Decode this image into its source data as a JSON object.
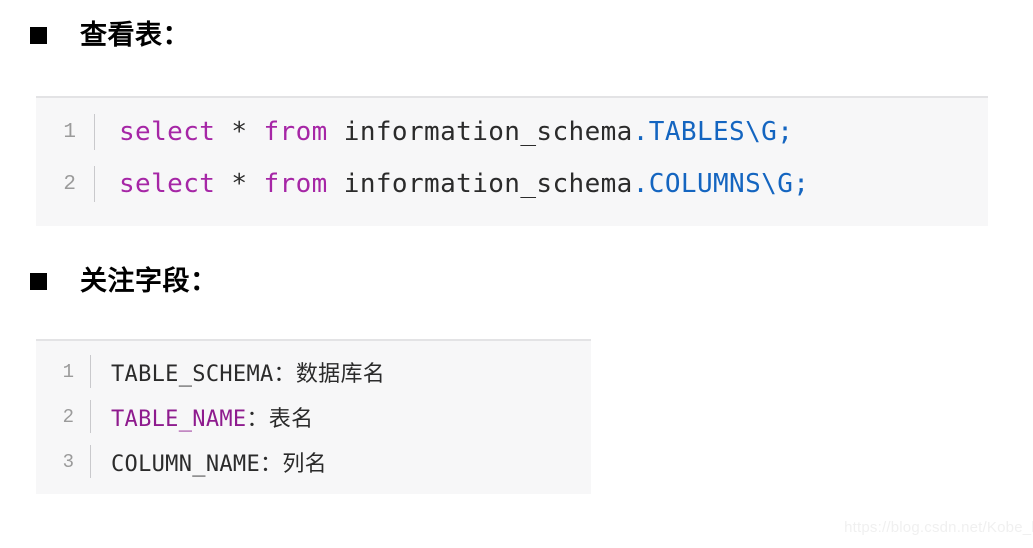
{
  "sections": [
    {
      "heading": "查看表：",
      "bullet": "filled-square-bullet"
    },
    {
      "heading": "关注字段：",
      "bullet": "filled-square-bullet"
    }
  ],
  "code_block_1": {
    "language": "sql",
    "lines": [
      {
        "number": "1",
        "full_text": "select * from information_schema.TABLES\\G;",
        "tokens": {
          "keyword_1": "select",
          "star": " * ",
          "keyword_2": "from",
          "identifier": " information_schema",
          "type": ".TABLES\\G;"
        }
      },
      {
        "number": "2",
        "full_text": "select * from information_schema.COLUMNS\\G;",
        "tokens": {
          "keyword_1": "select",
          "star": " * ",
          "keyword_2": "from",
          "identifier": " information_schema",
          "type": ".COLUMNS\\G;"
        }
      }
    ]
  },
  "code_block_2": {
    "language": "text",
    "lines": [
      {
        "number": "1",
        "full_text": "TABLE_SCHEMA：数据库名",
        "tokens": {
          "field": "TABLE_SCHEMA",
          "separator": "：",
          "description": "数据库名"
        },
        "highlighted": "false"
      },
      {
        "number": "2",
        "full_text": "TABLE_NAME：表名",
        "tokens": {
          "field": "TABLE_NAME",
          "separator": "：",
          "description": "表名"
        },
        "highlighted": "true"
      },
      {
        "number": "3",
        "full_text": "COLUMN_NAME：列名",
        "tokens": {
          "field": "COLUMN_NAME",
          "separator": "：",
          "description": "列名"
        },
        "highlighted": "false"
      }
    ]
  },
  "watermark": {
    "text": "https://blog.csdn.net/Kobe_k"
  },
  "colors": {
    "background": "#ffffff",
    "code_background": "#f7f7f8",
    "code_border": "#e3e3e5",
    "keyword_purple": "#a626a6",
    "field_purple": "#8e1b8e",
    "type_blue": "#1465c0",
    "text_dark": "#2b2b2b",
    "line_number_gray": "#9b9b9b",
    "watermark_gray": "#f0f0f0"
  }
}
